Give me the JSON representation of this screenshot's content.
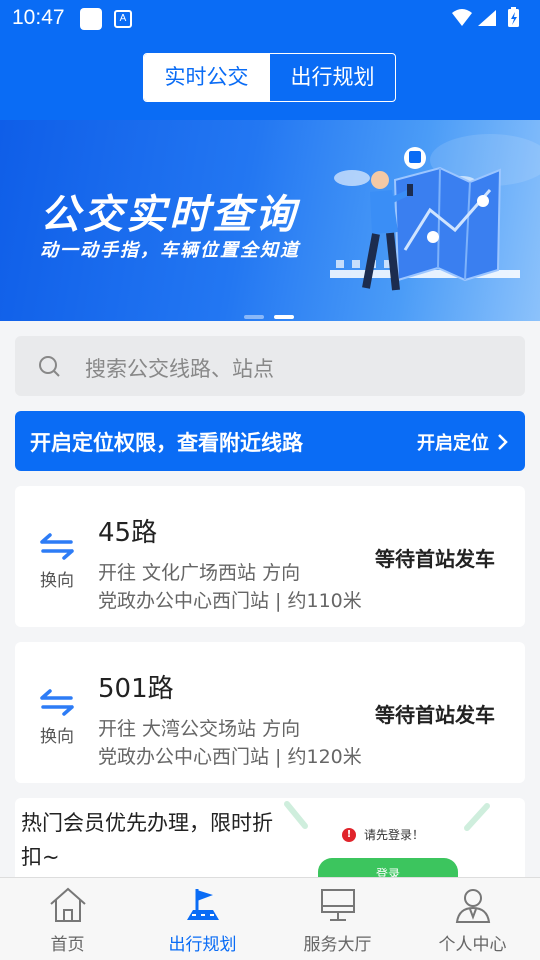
{
  "status_bar": {
    "time": "10:47",
    "notif_letter": "A"
  },
  "header": {
    "tabs": [
      {
        "label": "实时公交",
        "active": true
      },
      {
        "label": "出行规划",
        "active": false
      }
    ]
  },
  "banner": {
    "title": "公交实时查询",
    "subtitle": "动一动手指，车辆位置全知道",
    "page_count": 2,
    "active_page": 2
  },
  "search": {
    "placeholder": "搜索公交线路、站点"
  },
  "location": {
    "message": "开启定位权限，查看附近线路",
    "button": "开启定位"
  },
  "routes": [
    {
      "swap_label": "换向",
      "name": "45路",
      "direction": "开往 文化广场西站 方向",
      "nearby": "党政办公中心西门站 | 约110米",
      "status": "等待首站发车"
    },
    {
      "swap_label": "换向",
      "name": "501路",
      "direction": "开往 大湾公交场站 方向",
      "nearby": "党政办公中心西门站 | 约120米",
      "status": "等待首站发车"
    }
  ],
  "promo": {
    "text": "热门会员优先办理，限时折扣~",
    "error_text": "请先登录！",
    "login_button": "登录"
  },
  "tabbar": {
    "items": [
      {
        "label": "首页",
        "icon": "home-icon",
        "active": false
      },
      {
        "label": "出行规划",
        "icon": "route-flag-icon",
        "active": true
      },
      {
        "label": "服务大厅",
        "icon": "monitor-icon",
        "active": false
      },
      {
        "label": "个人中心",
        "icon": "user-icon",
        "active": false
      }
    ]
  },
  "colors": {
    "primary": "#0a6cf5",
    "login_green": "#3cc55e",
    "error_red": "#e0242b"
  }
}
